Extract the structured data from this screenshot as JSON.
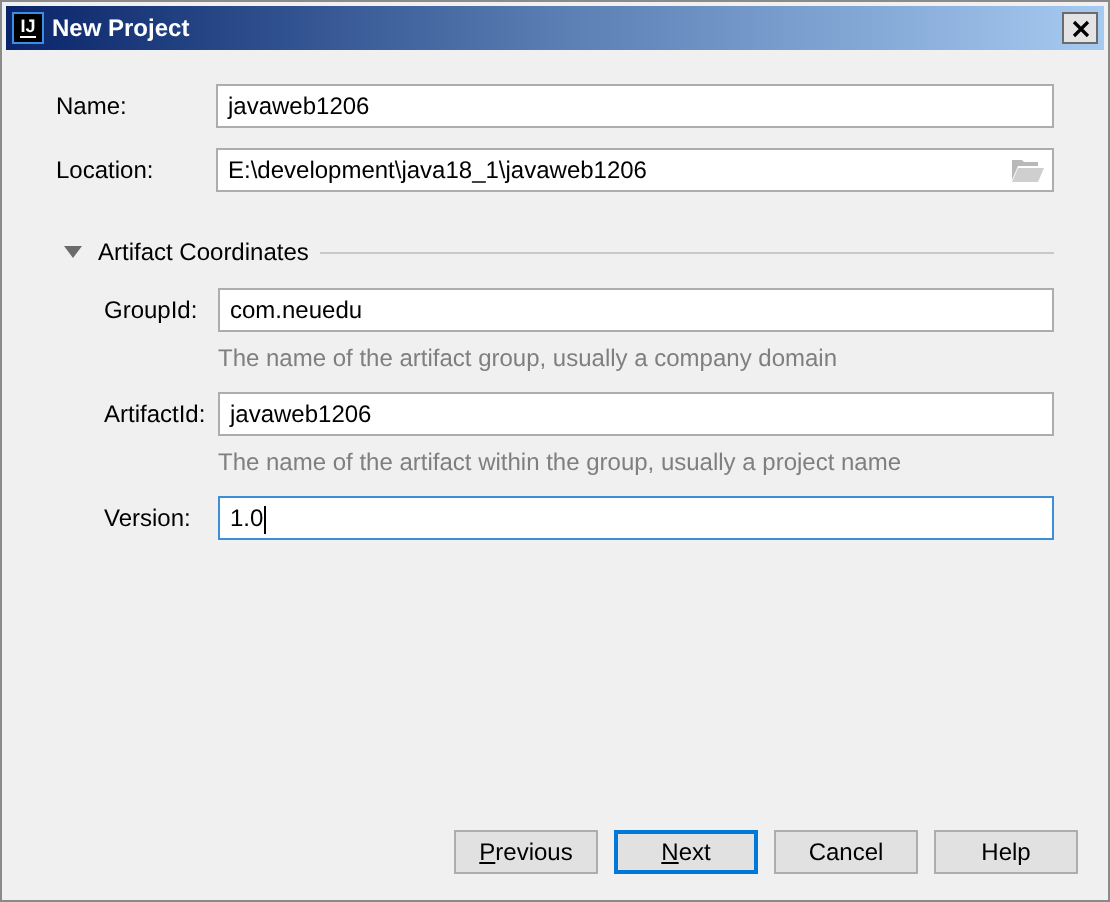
{
  "window": {
    "title": "New Project",
    "logo": "IJ"
  },
  "fields": [
    {
      "label": "Name:",
      "value": "javaweb1206",
      "kind": "text",
      "focused": false
    },
    {
      "label": "Location:",
      "value": "E:\\development\\java18_1\\javaweb1206",
      "kind": "path",
      "focused": false
    }
  ],
  "section": {
    "title": "Artifact Coordinates",
    "expanded": true,
    "fields": [
      {
        "label": "GroupId:",
        "value": "com.neuedu",
        "hint": "The name of the artifact group, usually a company domain",
        "focused": false
      },
      {
        "label": "ArtifactId:",
        "value": "javaweb1206",
        "hint": "The name of the artifact within the group, usually a project name",
        "focused": false
      },
      {
        "label": "Version:",
        "value": "1.0",
        "focused": true
      }
    ]
  },
  "buttons": [
    {
      "label": "Previous",
      "underline_first": true,
      "default": false
    },
    {
      "label": "Next",
      "underline_first": true,
      "default": true
    },
    {
      "label": "Cancel",
      "underline_first": false,
      "default": false
    },
    {
      "label": "Help",
      "underline_first": false,
      "default": false
    }
  ]
}
